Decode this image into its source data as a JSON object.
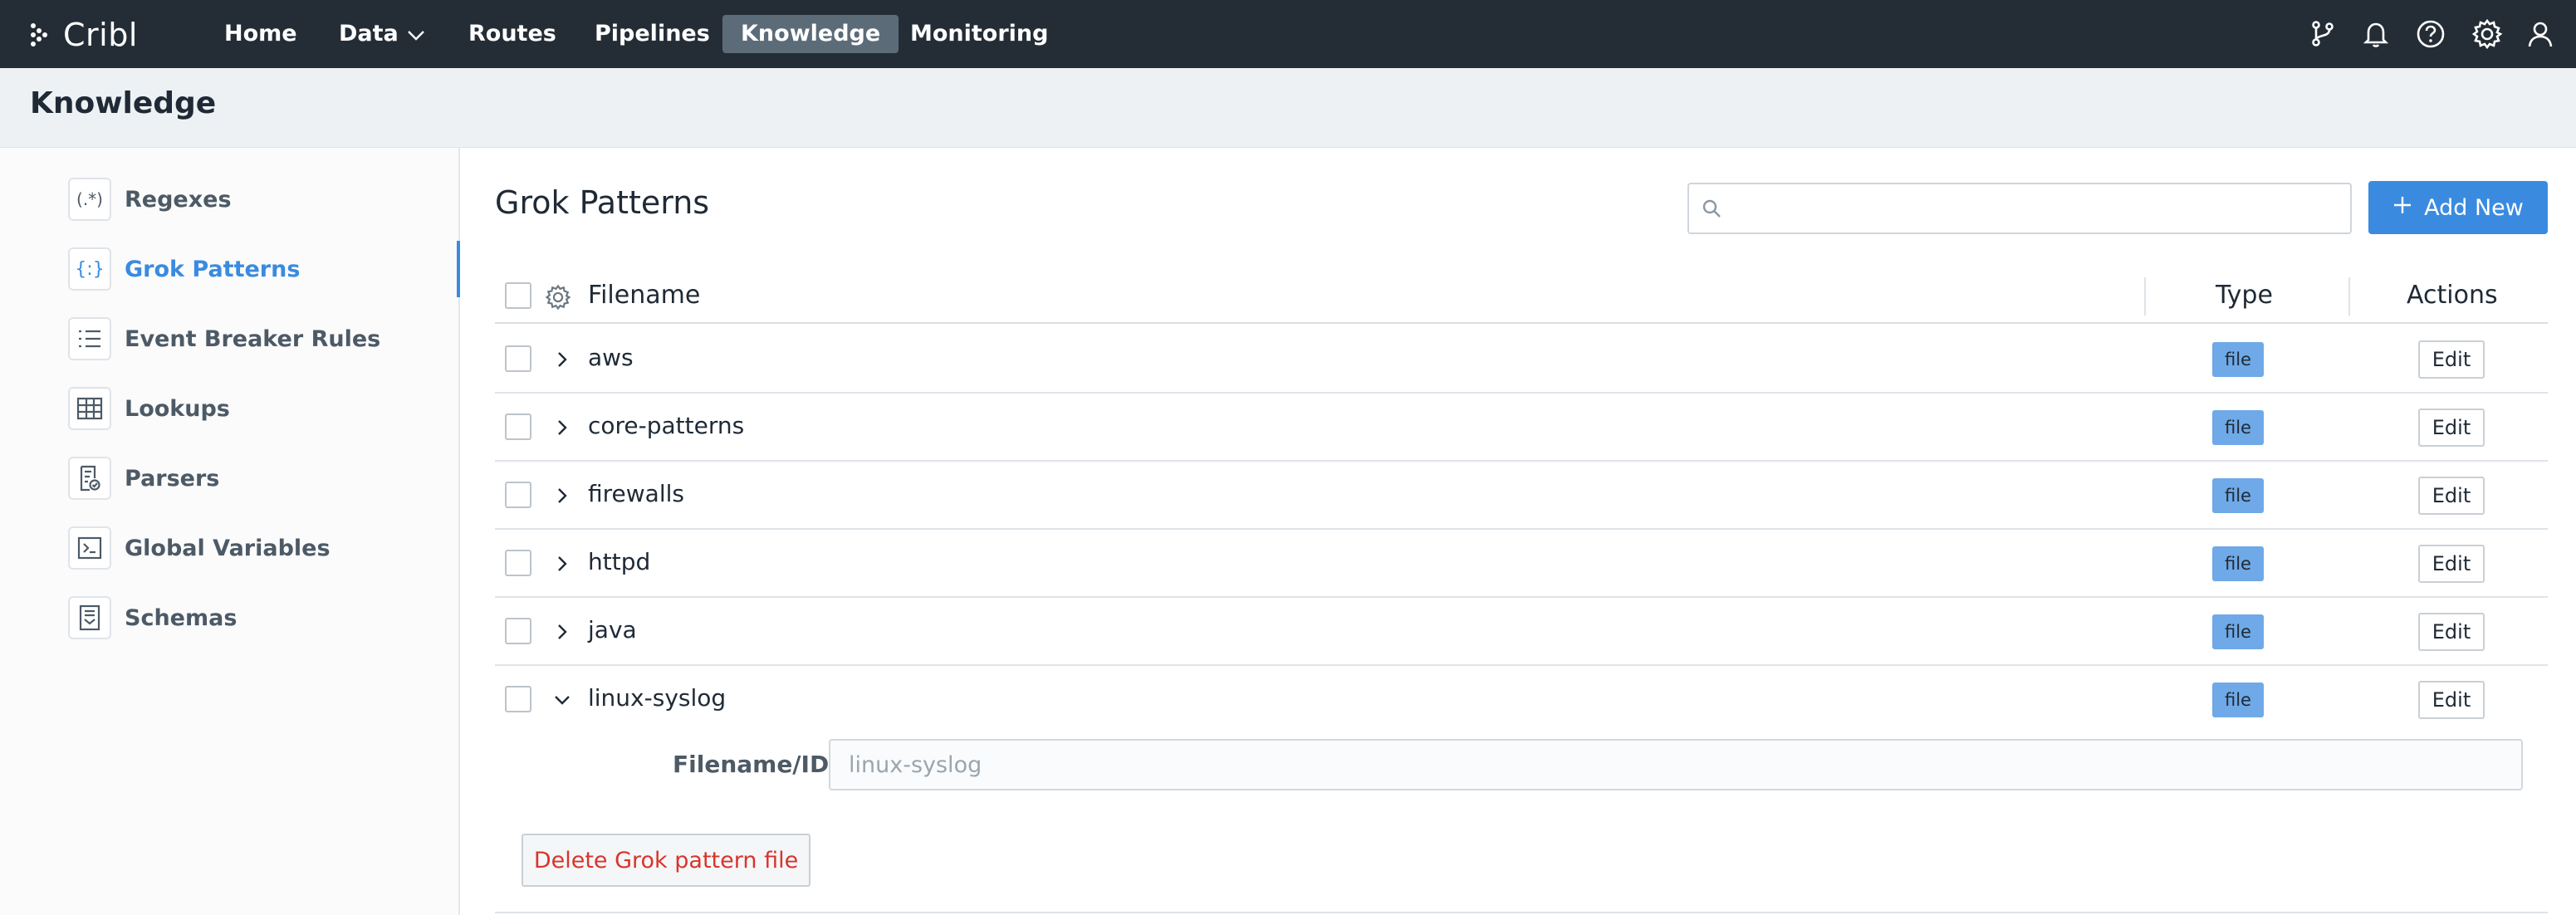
{
  "app": {
    "logo_text": "Cribl"
  },
  "nav": {
    "items": [
      {
        "label": "Home"
      },
      {
        "label": "Data"
      },
      {
        "label": "Routes"
      },
      {
        "label": "Pipelines"
      },
      {
        "label": "Knowledge"
      },
      {
        "label": "Monitoring"
      }
    ],
    "active": "Knowledge",
    "icons": [
      "git-branch-icon",
      "bell-icon",
      "help-icon",
      "gear-icon",
      "user-icon"
    ]
  },
  "page": {
    "title": "Knowledge"
  },
  "sidebar": {
    "items": [
      {
        "label": "Regexes",
        "icon": "regex-icon"
      },
      {
        "label": "Grok Patterns",
        "icon": "grok-icon"
      },
      {
        "label": "Event Breaker Rules",
        "icon": "list-icon"
      },
      {
        "label": "Lookups",
        "icon": "table-icon"
      },
      {
        "label": "Parsers",
        "icon": "parser-icon"
      },
      {
        "label": "Global Variables",
        "icon": "terminal-icon"
      },
      {
        "label": "Schemas",
        "icon": "schema-icon"
      }
    ],
    "active": "Grok Patterns"
  },
  "main": {
    "title": "Grok Patterns",
    "search": {
      "placeholder": "",
      "value": ""
    },
    "add_new_label": "Add New",
    "columns": {
      "filename": "Filename",
      "type": "Type",
      "actions": "Actions"
    },
    "rows": [
      {
        "filename": "aws",
        "type": "file",
        "action": "Edit",
        "expanded": false
      },
      {
        "filename": "core-patterns",
        "type": "file",
        "action": "Edit",
        "expanded": false
      },
      {
        "filename": "firewalls",
        "type": "file",
        "action": "Edit",
        "expanded": false
      },
      {
        "filename": "httpd",
        "type": "file",
        "action": "Edit",
        "expanded": false
      },
      {
        "filename": "java",
        "type": "file",
        "action": "Edit",
        "expanded": false
      },
      {
        "filename": "linux-syslog",
        "type": "file",
        "action": "Edit",
        "expanded": true
      }
    ],
    "expanded_row": {
      "field_label": "Filename/ID*",
      "field_value": "linux-syslog",
      "delete_label": "Delete Grok pattern file"
    }
  },
  "colors": {
    "nav_bg": "#242d36",
    "accent": "#3a8be0",
    "badge": "#6fa9e7",
    "danger": "#d9342b"
  }
}
